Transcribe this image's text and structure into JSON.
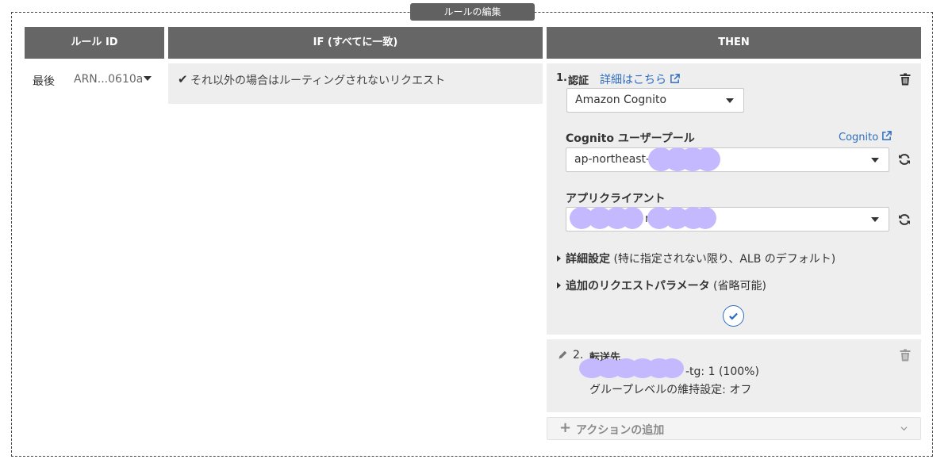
{
  "frame": {
    "title": "ルールの編集"
  },
  "headers": {
    "rule_id": "ルール ID",
    "if": "IF (すべてに一致)",
    "then": "THEN"
  },
  "rule": {
    "position": "最後",
    "arn": "ARN...0610a"
  },
  "if_condition": {
    "text": "それ以外の場合はルーティングされないリクエスト"
  },
  "auth_action": {
    "number": "1.",
    "title": "認証",
    "details_link": "詳細はこちら",
    "provider_value": "Amazon Cognito",
    "user_pool_label": "Cognito ユーザープール",
    "cognito_link": "Cognito",
    "user_pool_value": "ap-northeast-1_",
    "app_client_label": "アプリクライアント",
    "app_client_value_fragment": "n",
    "advanced_label": "詳細設定",
    "advanced_note": "(特に指定されない限り、ALB のデフォルト)",
    "extra_params_label": "追加のリクエストパラメータ",
    "extra_params_note": "(省略可能)"
  },
  "forward_action": {
    "number": "2.",
    "title": "転送先",
    "target_fragment": "-tg: 1 (100%)",
    "stickiness": "グループレベルの維持設定: オフ"
  },
  "add_action": {
    "label": "アクションの追加"
  },
  "colors": {
    "header_bg": "#666666",
    "panel_bg": "#eeeeee",
    "link": "#2e6dc0",
    "redaction": "#c4b8ff"
  }
}
